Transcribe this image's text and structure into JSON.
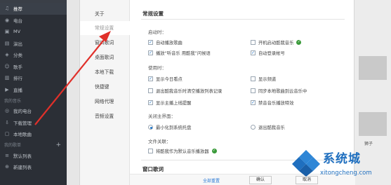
{
  "sidebar": {
    "items": [
      {
        "label": "推荐",
        "icon": "music-note-icon",
        "active": true
      },
      {
        "label": "电台",
        "icon": "radio-icon"
      },
      {
        "label": "MV",
        "icon": "mv-icon"
      },
      {
        "label": "演出",
        "icon": "ticket-icon"
      },
      {
        "label": "分类",
        "icon": "category-icon"
      },
      {
        "label": "歌手",
        "icon": "singer-icon"
      },
      {
        "label": "排行",
        "icon": "chart-icon"
      },
      {
        "label": "直播",
        "icon": "live-icon"
      }
    ],
    "my_music_header": "我的音乐",
    "my_music": [
      {
        "label": "我的电台",
        "icon": "my-radio-icon"
      },
      {
        "label": "下载管理",
        "icon": "download-icon"
      },
      {
        "label": "本地歌曲",
        "icon": "local-music-icon"
      }
    ],
    "playlist_header": "我的歌单",
    "playlist_add": "+",
    "playlists": [
      {
        "label": "默认列表",
        "icon": "list-icon"
      },
      {
        "label": "新建列表",
        "icon": "add-list-icon"
      }
    ]
  },
  "dialog": {
    "nav": [
      {
        "label": "关于",
        "selected": false
      },
      {
        "label": "常规设置",
        "selected": true
      },
      {
        "label": "窗口歌词",
        "selected": false
      },
      {
        "label": "桌面歌词",
        "selected": false
      },
      {
        "label": "本地下载",
        "selected": false
      },
      {
        "label": "快捷键",
        "selected": false
      },
      {
        "label": "网络代理",
        "selected": false
      },
      {
        "label": "音频设置",
        "selected": false
      }
    ],
    "section_title": "常规设置",
    "startup": {
      "title": "启动时：",
      "options": [
        {
          "label": "自动播放歌曲",
          "checked": true
        },
        {
          "label": "开机启动酷我音乐",
          "checked": false,
          "has_shield": true
        },
        {
          "label": "播放“听音乐 用酷我”问候语",
          "checked": true
        },
        {
          "label": "自动登录帐号",
          "checked": true
        }
      ]
    },
    "usage": {
      "title": "使用时：",
      "options": [
        {
          "label": "显示今日看点",
          "checked": true
        },
        {
          "label": "显示频道",
          "checked": false
        },
        {
          "label": "退出酷我音乐时清空播放列表记录",
          "checked": false
        },
        {
          "label": "同步本地歌曲到云音乐中",
          "checked": false
        },
        {
          "label": "显示主播上线提醒",
          "checked": true
        },
        {
          "label": "禁音音乐播放特效",
          "checked": true
        }
      ]
    },
    "close_main": {
      "title": "关闭主界面：",
      "options": [
        {
          "label": "最小化到系统托盘",
          "selected": true
        },
        {
          "label": "退出酷我音乐",
          "selected": false
        }
      ]
    },
    "file_assoc": {
      "title": "文件关联：",
      "option": {
        "label": "将酷我作为默认音乐播放器",
        "checked": false,
        "has_shield": true
      }
    },
    "next_section_title": "窗口歌词",
    "footer": {
      "reset_label": "全部重置",
      "ok_label": "确认",
      "cancel_label": "取消"
    }
  },
  "background": {
    "caption": "狮子"
  },
  "watermark": {
    "cn": "系统城",
    "en": "xitongcheng.com"
  },
  "colors": {
    "sidebar_bg": "#2b2f36",
    "accent": "#1d74c9",
    "annotation_arrow": "#e0302a",
    "watermark": "#1f6fbf"
  }
}
